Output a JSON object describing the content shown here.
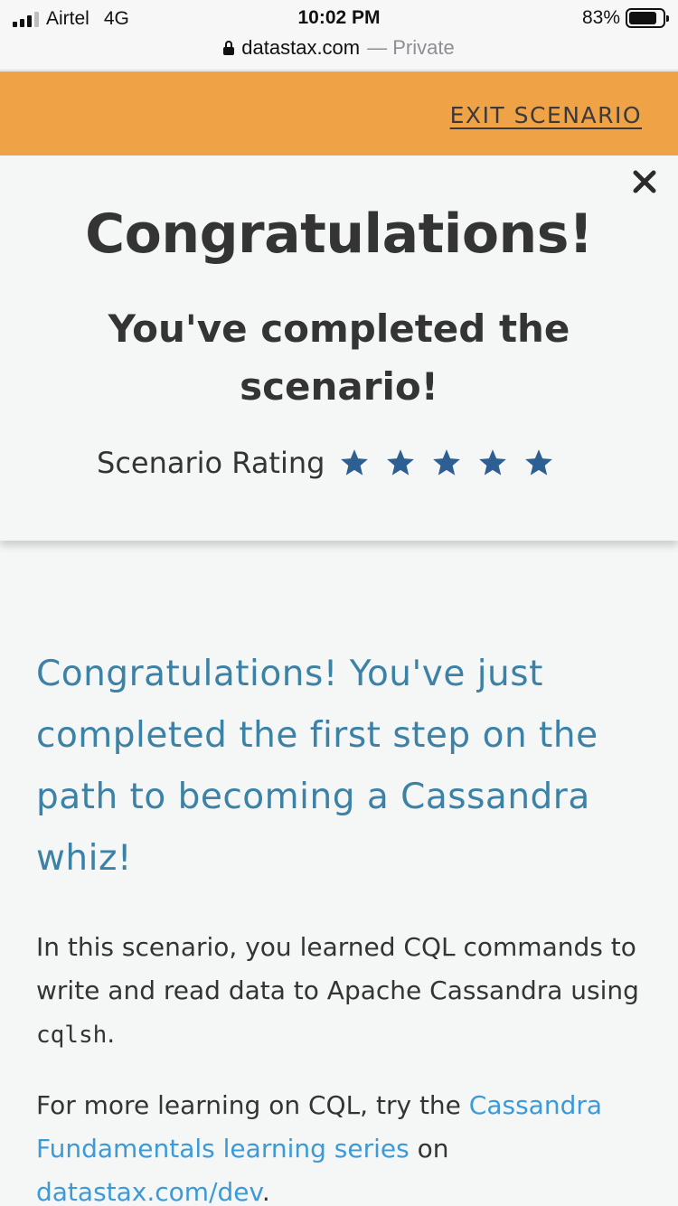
{
  "status_bar": {
    "carrier": "Airtel",
    "network": "4G",
    "time": "10:02 PM",
    "battery": "83%",
    "battery_level": 0.83,
    "url": "datastax.com",
    "url_suffix": "— Private"
  },
  "header": {
    "exit_label": "EXIT SCENARIO",
    "background_color": "#f0a247"
  },
  "modal": {
    "title": "Congratulations!",
    "subtitle": "You've completed the scenario!",
    "rating_label": "Scenario Rating",
    "rating_stars": 5,
    "star_color": "#2e5f93",
    "close_icon": "close-icon"
  },
  "content": {
    "headline": "Congratulations! You've just completed the first step on the path to becoming a Cassandra whiz!",
    "para1_text": "In this scenario, you learned CQL commands to write and read data to Apache Cassandra using ",
    "para1_code": "cqlsh",
    "para1_end": ".",
    "para2_text": "For more learning on CQL, try the ",
    "para2_link": "Cassandra Fundamentals learning series",
    "para2_mid": " on ",
    "para2_link2": "datastax.com/dev",
    "para2_end": ".",
    "headline_color": "#3c82a6",
    "link_color": "#3c9ad6"
  }
}
